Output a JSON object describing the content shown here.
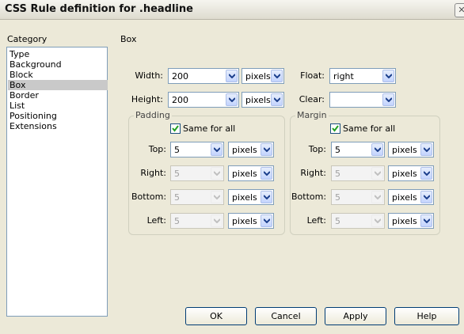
{
  "window": {
    "title": "CSS Rule definition for .headline"
  },
  "category": {
    "heading": "Category",
    "items": [
      "Type",
      "Background",
      "Block",
      "Box",
      "Border",
      "List",
      "Positioning",
      "Extensions"
    ],
    "selected": "Box"
  },
  "section_title": "Box",
  "fields": {
    "width": {
      "label": "Width:",
      "value": "200",
      "unit": "pixels"
    },
    "height": {
      "label": "Height:",
      "value": "200",
      "unit": "pixels"
    },
    "float": {
      "label": "Float:",
      "value": "right"
    },
    "clear": {
      "label": "Clear:",
      "value": ""
    }
  },
  "padding": {
    "legend": "Padding",
    "same_for_all": "Same for all",
    "same_checked": true,
    "top": {
      "label": "Top:",
      "value": "5",
      "unit": "pixels"
    },
    "right": {
      "label": "Right:",
      "value": "5",
      "unit": "pixels"
    },
    "bottom": {
      "label": "Bottom:",
      "value": "5",
      "unit": "pixels"
    },
    "left": {
      "label": "Left:",
      "value": "5",
      "unit": "pixels"
    }
  },
  "margin": {
    "legend": "Margin",
    "same_for_all": "Same for all",
    "same_checked": true,
    "top": {
      "label": "Top:",
      "value": "5",
      "unit": "pixels"
    },
    "right": {
      "label": "Right:",
      "value": "5",
      "unit": "pixels"
    },
    "bottom": {
      "label": "Bottom:",
      "value": "5",
      "unit": "pixels"
    },
    "left": {
      "label": "Left:",
      "value": "5",
      "unit": "pixels"
    }
  },
  "buttons": {
    "ok": "OK",
    "cancel": "Cancel",
    "apply": "Apply",
    "help": "Help"
  },
  "icons": {
    "close": "close-icon",
    "dropdown": "chevron-down-icon",
    "check": "checkmark-icon"
  }
}
